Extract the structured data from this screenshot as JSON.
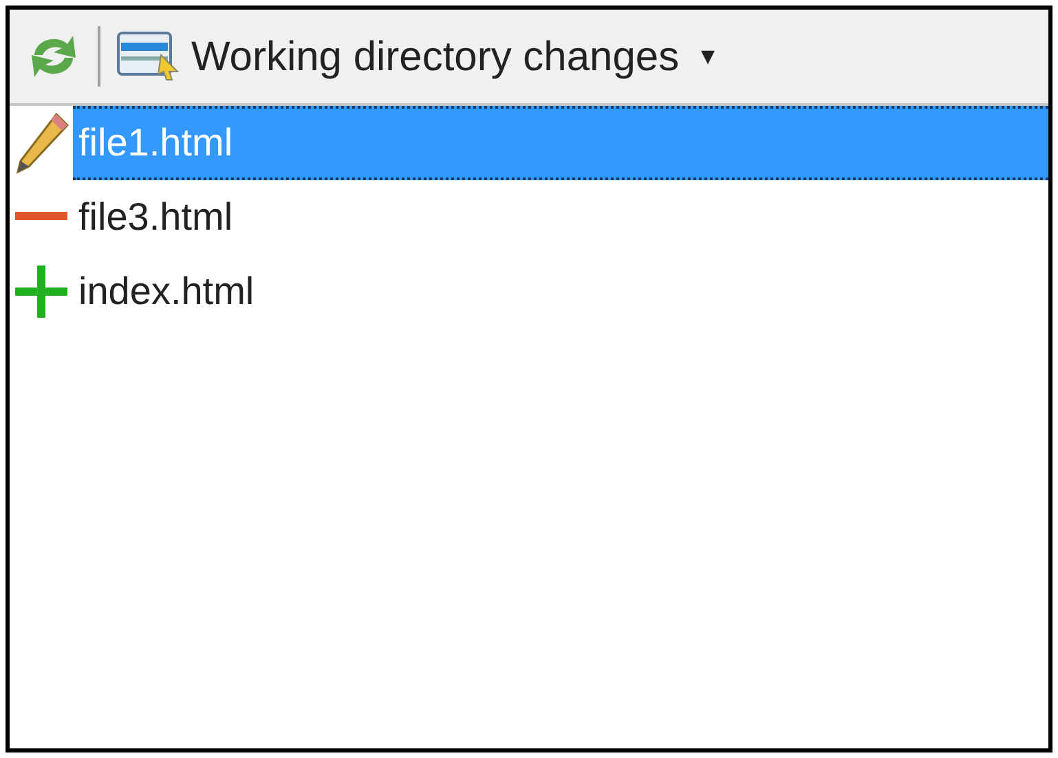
{
  "toolbar": {
    "view_menu": {
      "label": "Working directory changes",
      "caret": "▾"
    }
  },
  "files": [
    {
      "name": "file1.html",
      "kind": "modified",
      "selected": true
    },
    {
      "name": "file3.html",
      "kind": "removed",
      "selected": false
    },
    {
      "name": "index.html",
      "kind": "added",
      "selected": false
    }
  ]
}
